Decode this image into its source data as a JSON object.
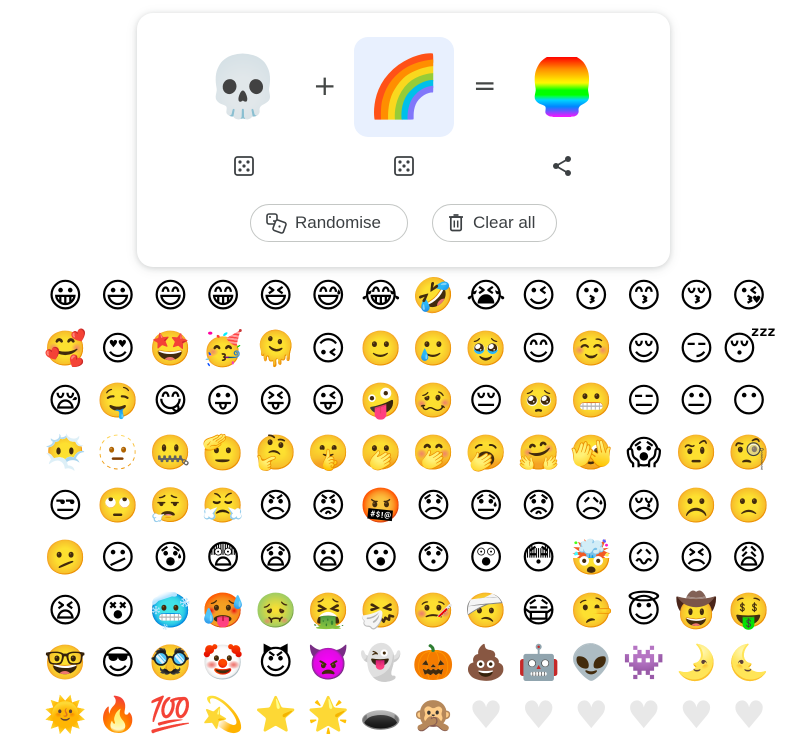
{
  "kitchen": {
    "left_emoji": "💀",
    "right_emoji": "🌈",
    "plus": "+",
    "equals": "=",
    "result_emoji": "💀",
    "randomise_label": "Randomise",
    "clear_label": "Clear all"
  },
  "colors": {
    "selected_slot_bg": "#e8f0fe",
    "icon": "#3c4043"
  },
  "emoji_grid": [
    "😀",
    "😃",
    "😄",
    "😁",
    "😆",
    "😅",
    "😂",
    "🤣",
    "😭",
    "😉",
    "😗",
    "😙",
    "😚",
    "😘",
    "🥰",
    "😍",
    "🤩",
    "🥳",
    "🫠",
    "🙃",
    "🙂",
    "🥲",
    "🥹",
    "😊",
    "☺️",
    "😌",
    "😏",
    "😴",
    "😪",
    "🤤",
    "😋",
    "😛",
    "😝",
    "😜",
    "🤪",
    "🥴",
    "😔",
    "🥺",
    "😬",
    "😑",
    "😐",
    "😶",
    "😶‍🌫️",
    "🫥",
    "🤐",
    "🫡",
    "🤔",
    "🤫",
    "🫢",
    "🤭",
    "🥱",
    "🤗",
    "🫣",
    "😱",
    "🤨",
    "🧐",
    "😒",
    "🙄",
    "😮‍💨",
    "😤",
    "😠",
    "😡",
    "🤬",
    "😞",
    "😓",
    "😟",
    "😥",
    "😢",
    "☹️",
    "🙁",
    "🫤",
    "😕",
    "😰",
    "😨",
    "😧",
    "😦",
    "😮",
    "😯",
    "😲",
    "😳",
    "🤯",
    "😖",
    "😣",
    "😩",
    "😫",
    "😵",
    "🥶",
    "🥵",
    "🤢",
    "🤮",
    "🤧",
    "🤒",
    "🤕",
    "😷",
    "🤥",
    "😇",
    "🤠",
    "🤑",
    "🤓",
    "😎",
    "🥸",
    "🤡",
    "😈",
    "👿",
    "👻",
    "🎃",
    "💩",
    "🤖",
    "👽",
    "👾",
    "🌛",
    "🌜",
    "🌞",
    "🔥",
    "💯",
    "💫",
    "⭐",
    "🌟",
    "🕳️",
    "🙊",
    "♥",
    "♥",
    "♥",
    "♥",
    "♥",
    "♥"
  ]
}
